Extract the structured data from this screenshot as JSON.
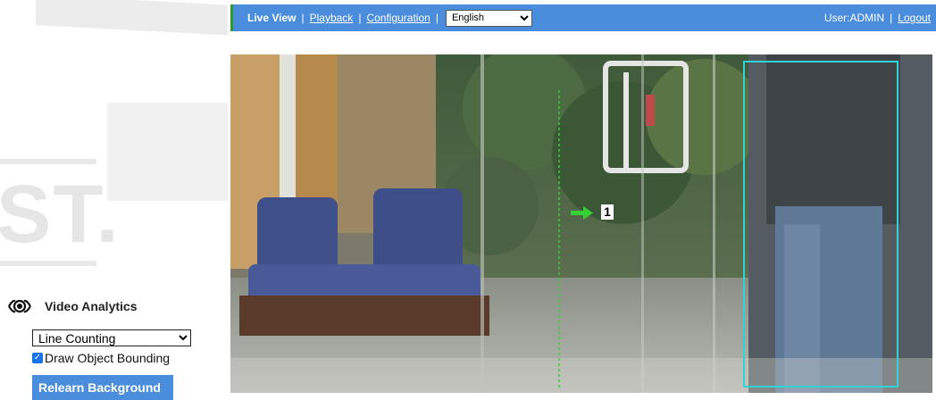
{
  "nav": {
    "live_view": "Live View",
    "separator": "|",
    "playback": "Playback",
    "configuration": "Configuration",
    "language": "English",
    "user": "User:ADMIN",
    "logout": "Logout"
  },
  "video": {
    "object_number": "1"
  },
  "analytics": {
    "title": "Video Analytics",
    "mode": "Line Counting",
    "draw_bounding_label": "Draw Object Bounding",
    "draw_bounding_checked": true,
    "relearn_button": "Relearn Background"
  },
  "colors": {
    "nav_bar": "#4a8ddc",
    "nav_accent": "#2e9a2e",
    "counting_line": "#37d037",
    "bounding_box": "#2fd3d3",
    "button": "#4a8ddc"
  },
  "icons": {
    "analytics": "eye-icon",
    "direction": "arrow-right-icon"
  }
}
